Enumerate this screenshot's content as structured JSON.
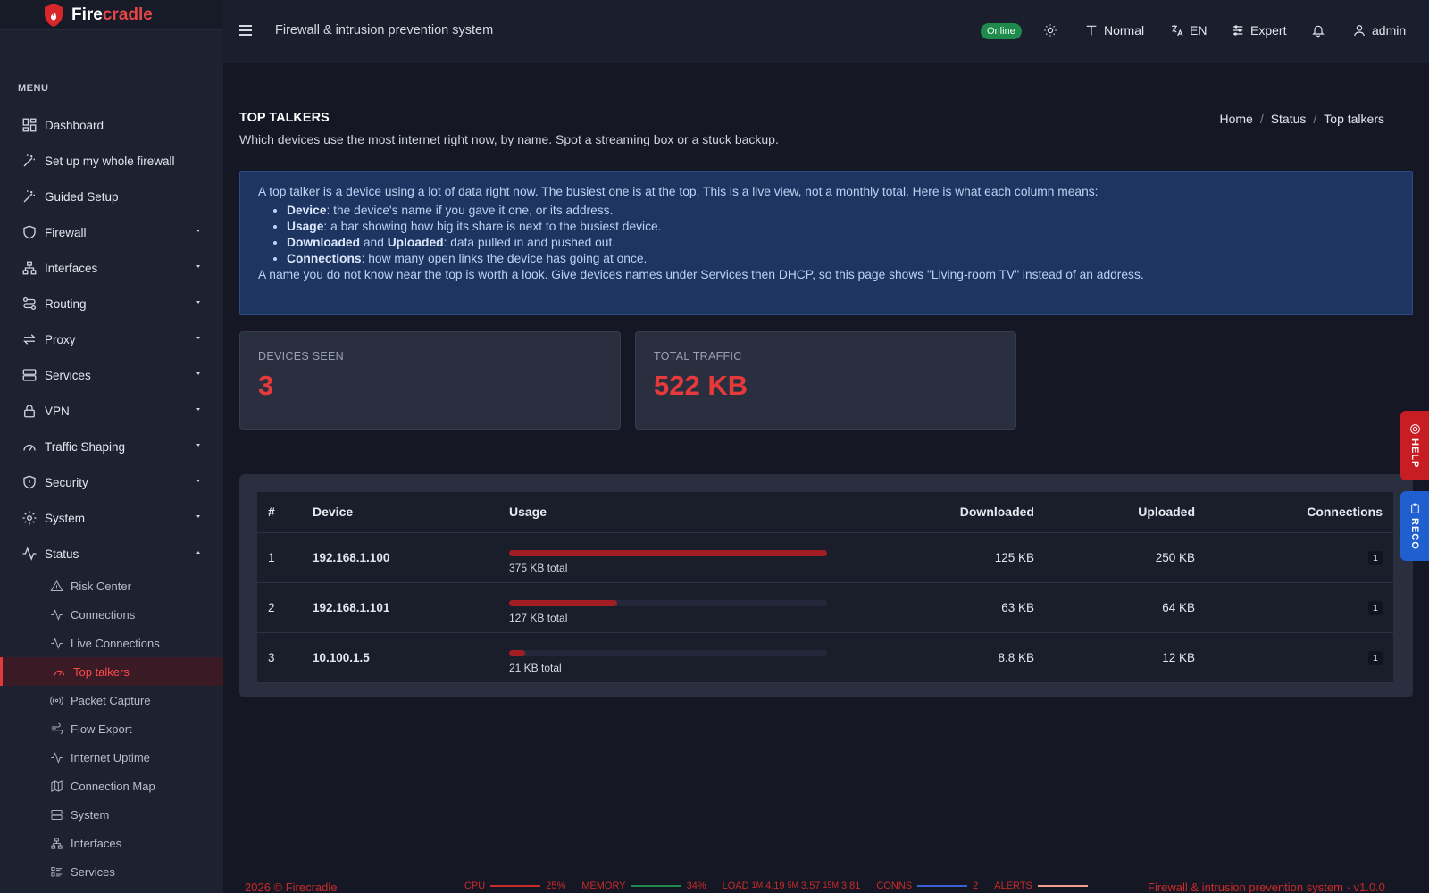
{
  "brand": {
    "name_prefix": "Fire",
    "name_suffix": "cradle"
  },
  "sidebar": {
    "menu_title": "MENU",
    "items": [
      {
        "label": "Dashboard",
        "icon": "dashboard-icon"
      },
      {
        "label": "Set up my whole firewall",
        "icon": "wand-icon"
      },
      {
        "label": "Guided Setup",
        "icon": "wand-icon"
      },
      {
        "label": "Firewall",
        "icon": "shield-icon"
      },
      {
        "label": "Interfaces",
        "icon": "network-icon"
      },
      {
        "label": "Routing",
        "icon": "route-icon"
      },
      {
        "label": "Proxy",
        "icon": "arrows-icon"
      },
      {
        "label": "Services",
        "icon": "server-icon"
      },
      {
        "label": "VPN",
        "icon": "lock-icon"
      },
      {
        "label": "Traffic Shaping",
        "icon": "gauge-icon"
      },
      {
        "label": "Security",
        "icon": "shield-alert-icon"
      },
      {
        "label": "System",
        "icon": "gear-icon"
      },
      {
        "label": "Status",
        "icon": "activity-icon"
      }
    ],
    "status_sub": [
      {
        "label": "Risk Center"
      },
      {
        "label": "Connections"
      },
      {
        "label": "Live Connections"
      },
      {
        "label": "Top talkers"
      },
      {
        "label": "Packet Capture"
      },
      {
        "label": "Flow Export"
      },
      {
        "label": "Internet Uptime"
      },
      {
        "label": "Connection Map"
      },
      {
        "label": "System"
      },
      {
        "label": "Interfaces"
      },
      {
        "label": "Services"
      }
    ]
  },
  "topbar": {
    "title": "Firewall & intrusion prevention system",
    "status": "Online",
    "text_size": "Normal",
    "language": "EN",
    "mode": "Expert",
    "user": "admin"
  },
  "page": {
    "title": "TOP TALKERS",
    "subtitle": "Which devices use the most internet right now, by name. Spot a streaming box or a stuck backup.",
    "breadcrumb": [
      "Home",
      "Status",
      "Top talkers"
    ]
  },
  "info": {
    "intro": "A top talker is a device using a lot of data right now. The busiest one is at the top. This is a live view, not a monthly total. Here is what each column means:",
    "device_term": "Device",
    "device_desc": ": the device's name if you gave it one, or its address.",
    "usage_term": "Usage",
    "usage_desc": ": a bar showing how big its share is next to the busiest device.",
    "downloaded_term": "Downloaded",
    "and_text": " and ",
    "uploaded_term": "Uploaded",
    "dlul_desc": ": data pulled in and pushed out.",
    "connections_term": "Connections",
    "connections_desc": ": how many open links the device has going at once.",
    "outro": "A name you do not know near the top is worth a look. Give devices names under Services then DHCP, so this page shows \"Living-room TV\" instead of an address."
  },
  "stats": {
    "devices_label": "DEVICES SEEN",
    "devices_value": "3",
    "traffic_label": "TOTAL TRAFFIC",
    "traffic_value": "522 KB"
  },
  "table": {
    "headers": [
      "#",
      "Device",
      "Usage",
      "Downloaded",
      "Uploaded",
      "Connections"
    ],
    "rows": [
      {
        "rank": "1",
        "device": "192.168.1.100",
        "usage_text": "375 KB total",
        "usage_share": 1.0,
        "downloaded": "125 KB",
        "uploaded": "250 KB",
        "connections": "1"
      },
      {
        "rank": "2",
        "device": "192.168.1.101",
        "usage_text": "127 KB total",
        "usage_share": 0.34,
        "downloaded": "63 KB",
        "uploaded": "64 KB",
        "connections": "1"
      },
      {
        "rank": "3",
        "device": "10.100.1.5",
        "usage_text": "21 KB total",
        "usage_share": 0.05,
        "downloaded": "8.8 KB",
        "uploaded": "12 KB",
        "connections": "1"
      }
    ]
  },
  "side_tabs": {
    "help": "HELP",
    "reco": "RECO"
  },
  "footer": {
    "copyright": "2026 © Firecradle",
    "cpu_label": "CPU",
    "cpu_value": "25%",
    "memory_label": "MEMORY",
    "memory_value": "34%",
    "load_label": "LOAD",
    "load_1m_label": "1M",
    "load_1m": "4.19",
    "load_5m_label": "5M",
    "load_5m": "3.57",
    "load_15m_label": "15M",
    "load_15m": "3.81",
    "conns_label": "CONNS",
    "conns_value": "2",
    "alerts_label": "ALERTS",
    "version": "Firewall & intrusion prevention system · v1.0.0"
  },
  "colors": {
    "accent": "#e63939",
    "online": "#1f8a4c",
    "help": "#c91d24",
    "reco": "#1f5fcf"
  }
}
